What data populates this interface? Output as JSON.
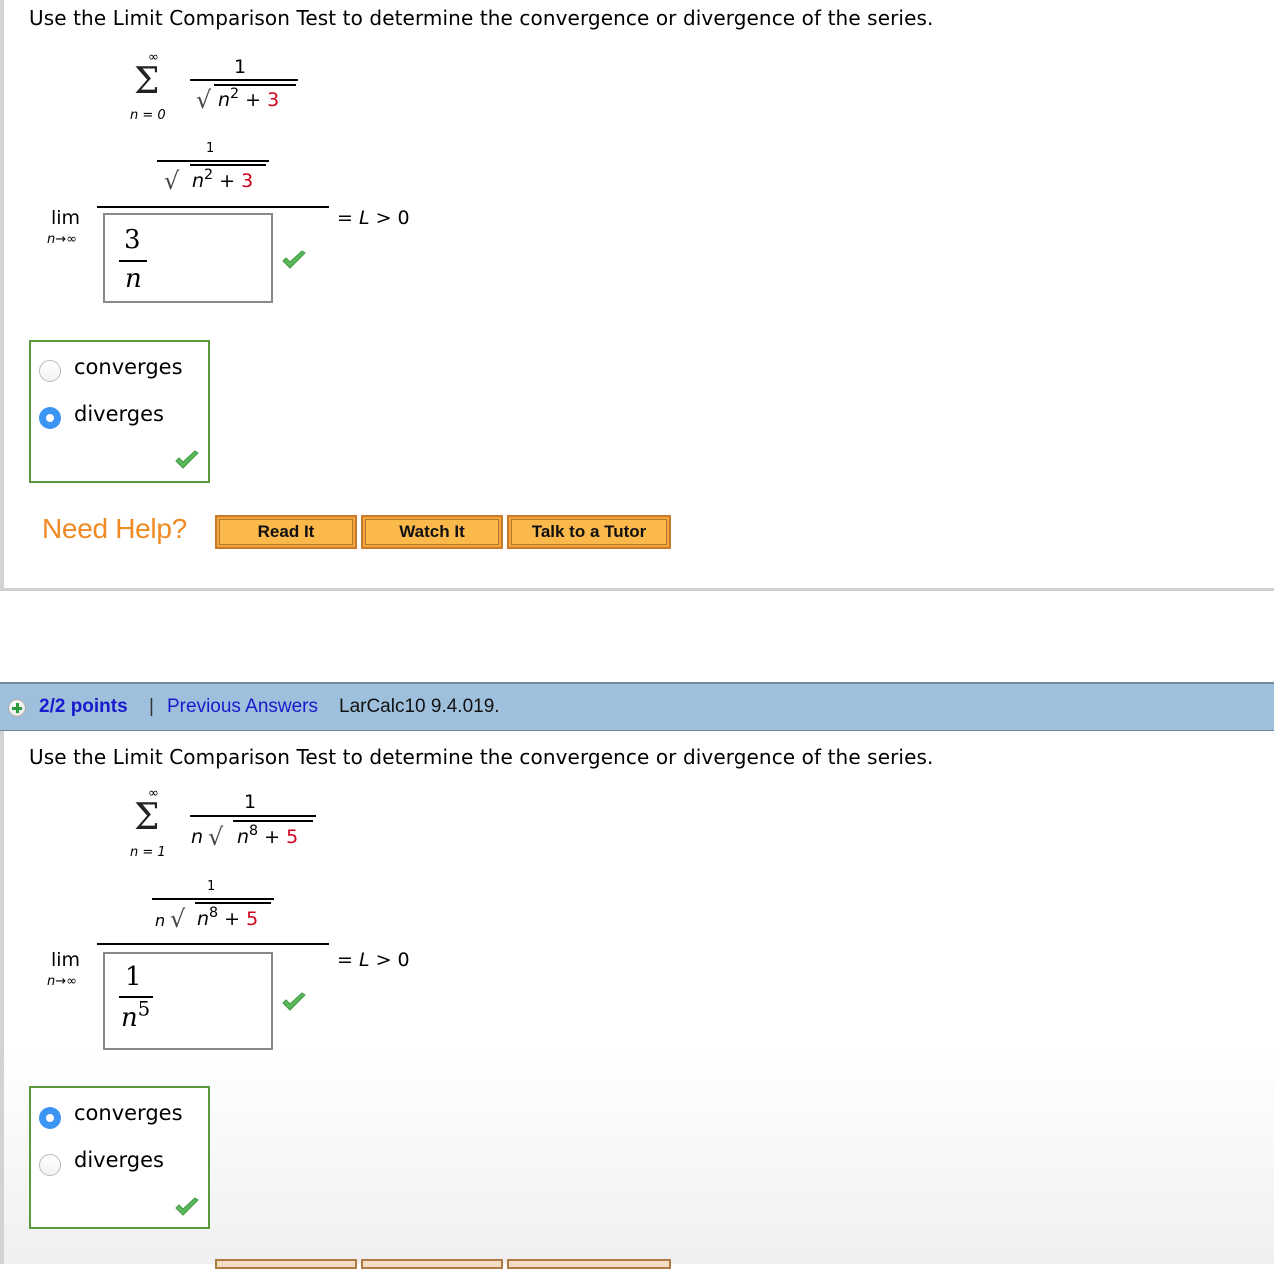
{
  "problem1": {
    "question": "Use the Limit Comparison Test to determine the convergence or divergence of the series.",
    "series": {
      "sum_upper": "∞",
      "sum_lower": "n = 0",
      "numerator": "1",
      "radicand_base": "n",
      "radicand_exp": "2",
      "radicand_plus": "+",
      "radicand_const": "3",
      "prefix_n": ""
    },
    "limit": {
      "lim_label": "lim",
      "lim_sub": "n→∞",
      "inner_numerator": "1",
      "answer_numerator": "3",
      "answer_denominator": "n",
      "answer_exp": "",
      "equals_text": "= ",
      "L": "L",
      "gt_zero": " > 0"
    },
    "choices": [
      {
        "label": "converges",
        "selected": false
      },
      {
        "label": "diverges",
        "selected": true
      }
    ],
    "need_help": "Need Help?",
    "help_buttons": [
      "Read It",
      "Watch It",
      "Talk to a Tutor"
    ]
  },
  "problem2": {
    "header": {
      "points": "2/2 points",
      "separator": "|",
      "previous_answers": "Previous Answers",
      "reference": "LarCalc10 9.4.019."
    },
    "question": "Use the Limit Comparison Test to determine the convergence or divergence of the series.",
    "series": {
      "sum_upper": "∞",
      "sum_lower": "n = 1",
      "numerator": "1",
      "prefix_n": "n",
      "radicand_base": "n",
      "radicand_exp": "8",
      "radicand_plus": "+",
      "radicand_const": "5"
    },
    "limit": {
      "lim_label": "lim",
      "lim_sub": "n→∞",
      "inner_numerator": "1",
      "answer_numerator": "1",
      "answer_denominator": "n",
      "answer_exp": "5",
      "equals_text": "= ",
      "L": "L",
      "gt_zero": " > 0"
    },
    "choices": [
      {
        "label": "converges",
        "selected": true
      },
      {
        "label": "diverges",
        "selected": false
      }
    ]
  },
  "colors": {
    "accent_red": "#d0021b",
    "correct_green": "#5b9a3b",
    "help_orange": "#f08a24",
    "header_blue": "#9fc0dc",
    "link_blue": "#1a1acc",
    "radio_blue": "#3c95f4"
  }
}
